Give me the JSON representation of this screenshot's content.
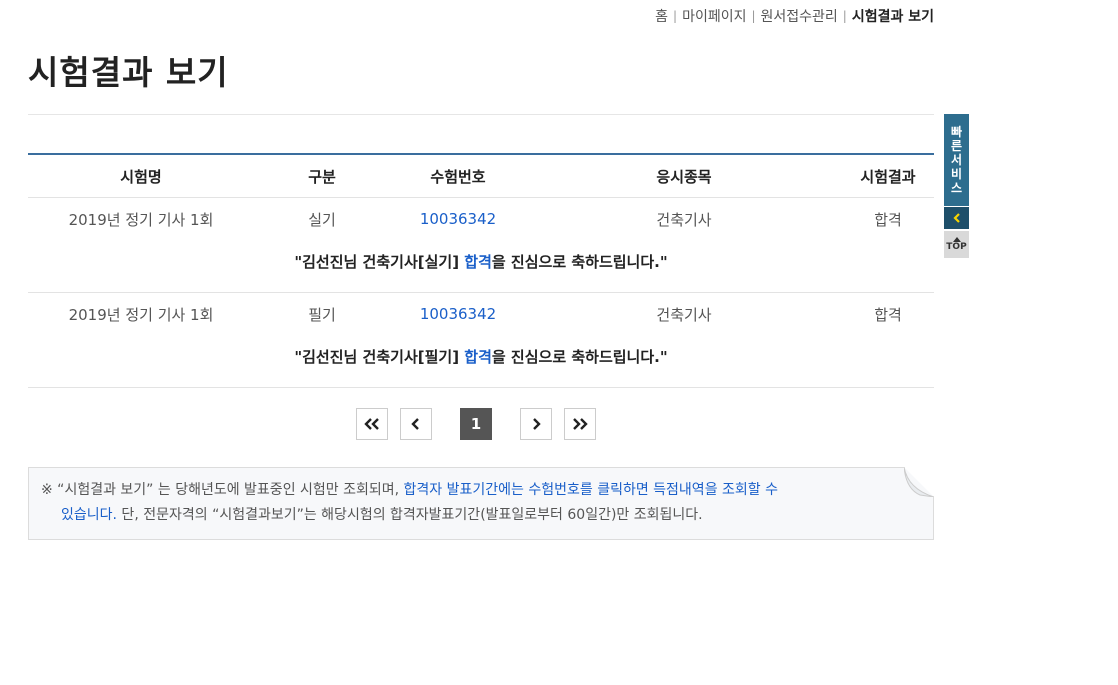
{
  "breadcrumb": [
    "홈",
    "마이페이지",
    "원서접수관리",
    "시험결과 보기"
  ],
  "page_title": "시험결과 보기",
  "table": {
    "headers": [
      "시험명",
      "구분",
      "수험번호",
      "응시종목",
      "시험결과"
    ],
    "rows": [
      {
        "exam": "2019년 정기 기사 1회",
        "type": "실기",
        "number": "10036342",
        "subject": "건축기사",
        "result": "합격",
        "msg_pre": "\"김선진님 건축기사[실기] ",
        "msg_pass": "합격",
        "msg_post": "을 진심으로 축하드립니다.\""
      },
      {
        "exam": "2019년 정기 기사 1회",
        "type": "필기",
        "number": "10036342",
        "subject": "건축기사",
        "result": "합격",
        "msg_pre": "\"김선진님 건축기사[필기] ",
        "msg_pass": "합격",
        "msg_post": "을 진심으로 축하드립니다.\""
      }
    ]
  },
  "pagination": {
    "current": "1"
  },
  "notice": {
    "mark": "※",
    "text1": " “시험결과 보기” 는 당해년도에 발표중인 시험만 조회되며, ",
    "highlight1": "합격자 발표기간에는 수험번호를 클릭하면 득점내역을 조회할 수",
    "highlight2": "있습니다.",
    "text2": " 단, 전문자격의 “시험결과보기”는 해당시험의 합격자발표기간(발표일로부터 60일간)만 조회됩니다."
  },
  "quick_menu": {
    "label": [
      "빠",
      "른",
      "서",
      "비",
      "스"
    ],
    "top_label": "TOP"
  }
}
